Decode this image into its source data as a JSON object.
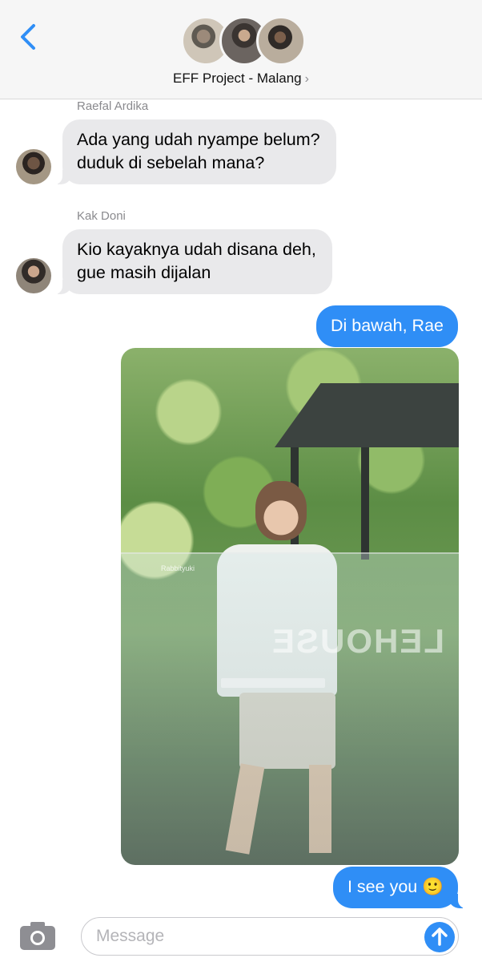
{
  "header": {
    "back_icon": "chevron-left-icon",
    "group_name": "EFF Project - Malang",
    "chevron": "›",
    "accent_color": "#2f8ef6"
  },
  "messages": [
    {
      "sender": "Raefal Ardika",
      "text_lines": [
        "Ada yang udah nyampe belum?",
        "duduk di sebelah mana?"
      ],
      "direction": "incoming"
    },
    {
      "sender": "Kak Doni",
      "text_lines": [
        "Kio kayaknya udah disana deh,",
        "gue masih dijalan"
      ],
      "direction": "incoming"
    },
    {
      "text": "Di bawah, Rae",
      "direction": "outgoing"
    },
    {
      "type": "photo",
      "direction": "outgoing",
      "watermark": "Rabbityuki",
      "glass_text": "LEHOUSE"
    },
    {
      "text": "I see you",
      "emoji": "🙂",
      "direction": "outgoing"
    }
  ],
  "composer": {
    "placeholder": "Message",
    "camera_icon": "camera-icon",
    "send_icon": "arrow-up-icon"
  },
  "colors": {
    "incoming_bubble": "#e9e9eb",
    "outgoing_bubble": "#2f8ef6",
    "header_bg": "#f6f6f6"
  }
}
